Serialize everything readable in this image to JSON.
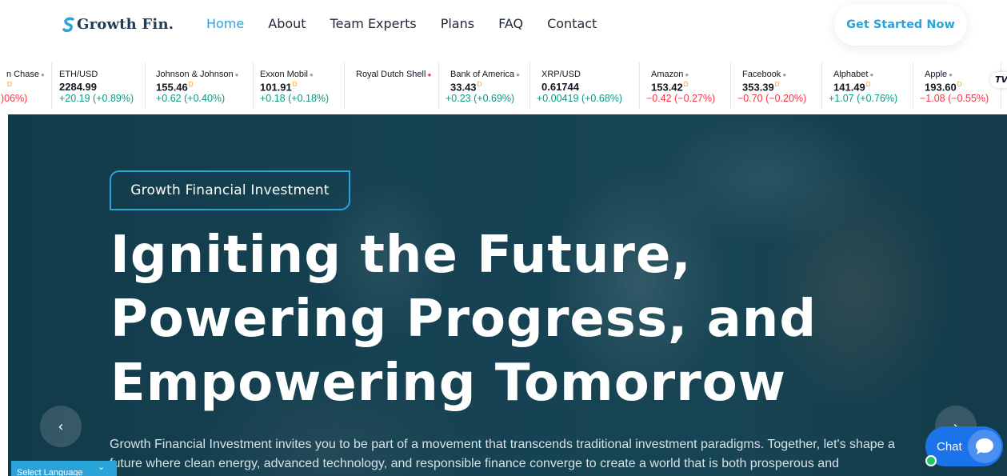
{
  "header": {
    "logo_text": "Growth Fin.",
    "nav": [
      {
        "label": "Home",
        "active": true
      },
      {
        "label": "About",
        "active": false
      },
      {
        "label": "Team Experts",
        "active": false
      },
      {
        "label": "Plans",
        "active": false
      },
      {
        "label": "FAQ",
        "active": false
      },
      {
        "label": "Contact",
        "active": false
      }
    ],
    "cta_label": "Get Started Now"
  },
  "ticker": {
    "items": [
      {
        "name": "n Chase",
        "price": "",
        "change": ")06%)",
        "dir": "down"
      },
      {
        "name": "ETH/USD",
        "price": "2284.99",
        "change": "+20.19 (+0.89%)",
        "dir": "up"
      },
      {
        "name": "Johnson & Johnson",
        "price": "155.46",
        "change": "+0.62 (+0.40%)",
        "dir": "up"
      },
      {
        "name": "Exxon Mobil",
        "price": "101.91",
        "change": "+0.18 (+0.18%)",
        "dir": "up"
      },
      {
        "name": "Royal Dutch Shell",
        "price": "",
        "change": "",
        "dir": "up"
      },
      {
        "name": "Bank of America",
        "price": "33.43",
        "change": "+0.23 (+0.69%)",
        "dir": "up"
      },
      {
        "name": "XRP/USD",
        "price": "0.61744",
        "change": "+0.00419 (+0.68%)",
        "dir": "up"
      },
      {
        "name": "Amazon",
        "price": "153.42",
        "change": "−0.42 (−0.27%)",
        "dir": "down"
      },
      {
        "name": "Facebook",
        "price": "353.39",
        "change": "−0.70 (−0.20%)",
        "dir": "down"
      },
      {
        "name": "Alphabet",
        "price": "141.49",
        "change": "+1.07 (+0.76%)",
        "dir": "up"
      },
      {
        "name": "Apple",
        "price": "193.60",
        "change": "−1.08 (−0.55%)",
        "dir": "down"
      }
    ],
    "delayed_marker": "D",
    "brand": "TV"
  },
  "hero": {
    "badge": "Growth Financial Investment",
    "title_lines": [
      "Igniting the Future,",
      "Powering Progress, and",
      "Empowering Tomorrow"
    ],
    "description_line1": "Growth Financial Investment invites you to be part of a movement that transcends traditional investment paradigms. Together, let's shape a",
    "description_line2": "future where clean energy, advanced technology, and responsible finance converge to create a world that is both prosperous and",
    "prev_label": "‹",
    "next_label": "›"
  },
  "language": {
    "label": "Select Language"
  },
  "chat": {
    "label": "Chat"
  },
  "colors": {
    "accent": "#2aa3d9",
    "hero_bg": "#1a4a5b",
    "up": "#089981",
    "down": "#f23645",
    "chat": "#1a73e8"
  }
}
